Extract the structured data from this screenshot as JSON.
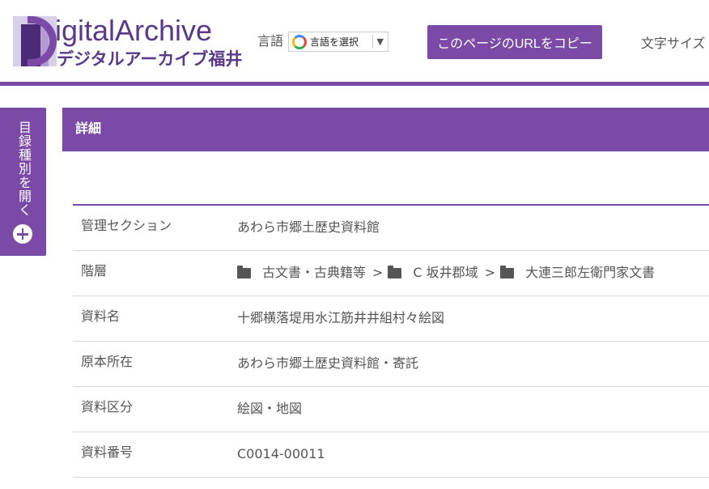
{
  "header": {
    "logo_en": "igitalArchive",
    "logo_ja": "デジタルアーカイブ福井",
    "lang_label": "言語",
    "lang_select_text": "言語を選択",
    "copy_url_button": "このページのURLをコピー",
    "font_size_label": "文字サイズ"
  },
  "sidebar": {
    "open_catalog_label": "目録種別を開く"
  },
  "section": {
    "title": "詳細"
  },
  "details": {
    "rows": [
      {
        "label": "管理セクション",
        "value": "あわら市郷土歴史資料館"
      },
      {
        "label": "階層",
        "breadcrumb": [
          "古文書・古典籍等",
          "C 坂井郡域",
          "大連三郎左衛門家文書"
        ],
        "separator": ">"
      },
      {
        "label": "資料名",
        "value": "十郷横落堤用水江筋井井組村々絵図"
      },
      {
        "label": "原本所在",
        "value": "あわら市郷土歴史資料館・寄託"
      },
      {
        "label": "資料区分",
        "value": "絵図・地図"
      },
      {
        "label": "資料番号",
        "value": "C0014-00011"
      }
    ]
  },
  "colors": {
    "accent": "#7a4aa6",
    "text": "#555555",
    "divider": "#d9d9d9"
  },
  "icons": [
    "google-g-icon",
    "dropdown-arrow-icon",
    "plus-circle-icon",
    "folder-icon"
  ]
}
